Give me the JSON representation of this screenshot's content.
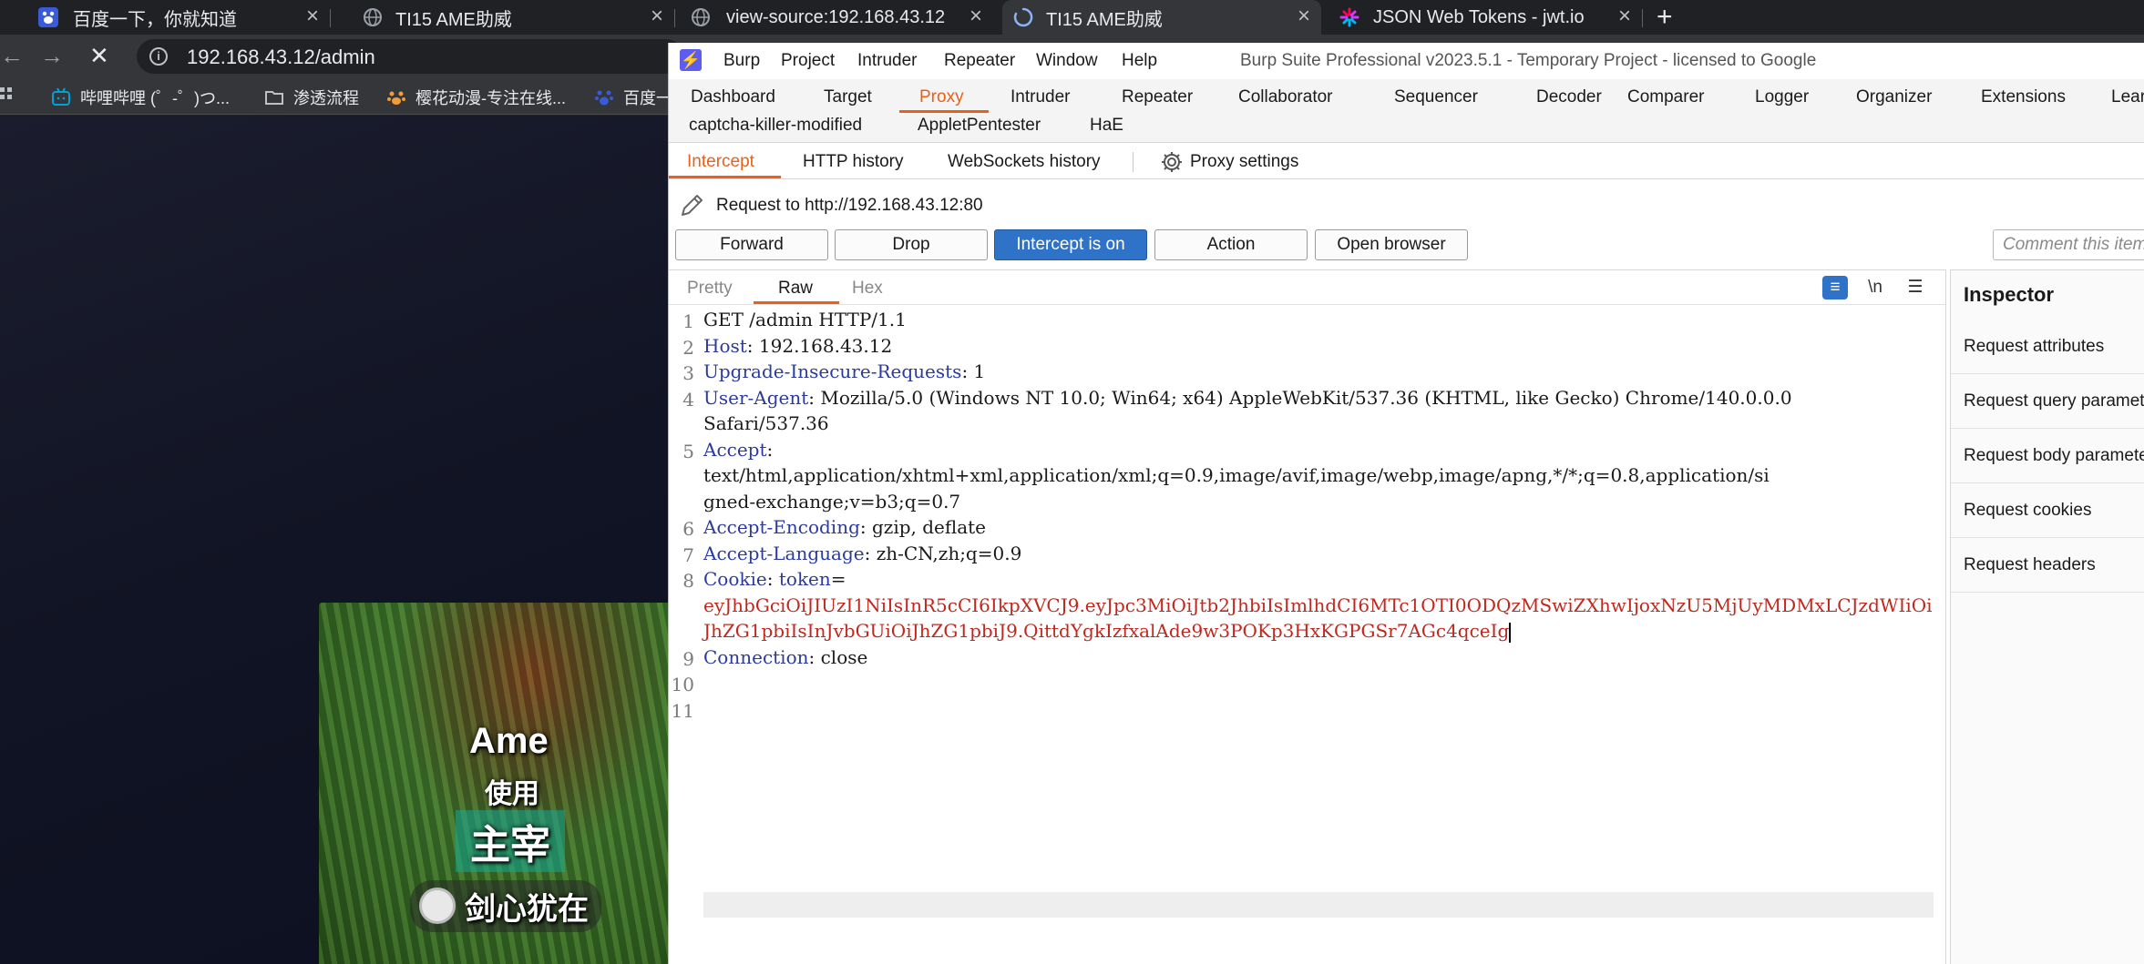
{
  "browser": {
    "tabs": [
      {
        "title": "百度一下，你就知道",
        "icon": "baidu-paw-icon"
      },
      {
        "title": "TI15 AME助威",
        "icon": "globe-icon"
      },
      {
        "title": "view-source:192.168.43.12",
        "icon": "globe-icon"
      },
      {
        "title": "TI15 AME助威",
        "icon": "loading-spinner-icon"
      },
      {
        "title": "JSON Web Tokens - jwt.io",
        "icon": "jwt-icon"
      }
    ],
    "address": "192.168.43.12/admin",
    "bookmarks": [
      {
        "label": "哔哩哔哩 (゜-゜)つ...",
        "icon": "bilibili-icon"
      },
      {
        "label": "渗透流程",
        "icon": "folder-icon"
      },
      {
        "label": "樱花动漫-专注在线...",
        "icon": "paw-icon"
      },
      {
        "label": "百度一",
        "icon": "baidu-paw-icon"
      }
    ],
    "video_overlay": {
      "line1": "Ame",
      "line2": "使用",
      "line3": "主宰",
      "line4": "剑心犹在"
    }
  },
  "burp": {
    "menu": [
      "Burp",
      "Project",
      "Intruder",
      "Repeater",
      "Window",
      "Help"
    ],
    "title": "Burp Suite Professional v2023.5.1 - Temporary Project - licensed to Google",
    "main_tabs_row1": [
      "Dashboard",
      "Target",
      "Proxy",
      "Intruder",
      "Repeater",
      "Collaborator",
      "Sequencer",
      "Decoder",
      "Comparer",
      "Logger",
      "Organizer",
      "Extensions",
      "Lear"
    ],
    "main_tabs_row2": [
      "captcha-killer-modified",
      "AppletPentester",
      "HaE"
    ],
    "active_main_tab": "Proxy",
    "sub_tabs": [
      "Intercept",
      "HTTP history",
      "WebSockets history"
    ],
    "proxy_settings": "Proxy settings",
    "request_to": "Request to http://192.168.43.12:80",
    "buttons": {
      "forward": "Forward",
      "drop": "Drop",
      "intercept": "Intercept is on",
      "action": "Action",
      "open_browser": "Open browser"
    },
    "comment_placeholder": "Comment this item",
    "editor_tabs": [
      "Pretty",
      "Raw",
      "Hex"
    ],
    "editor_icons": {
      "newline": "\\n"
    },
    "request_lines": [
      {
        "n": "1",
        "key": "",
        "val": "GET /admin HTTP/1.1"
      },
      {
        "n": "2",
        "key": "Host",
        "val": ": 192.168.43.12"
      },
      {
        "n": "3",
        "key": "Upgrade-Insecure-Requests",
        "val": ": 1"
      },
      {
        "n": "4",
        "key": "User-Agent",
        "val": ": Mozilla/5.0 (Windows NT 10.0; Win64; x64) AppleWebKit/537.36 (KHTML, like Gecko) Chrome/140.0.0.0"
      },
      {
        "n": "",
        "key": "",
        "val": "Safari/537.36"
      },
      {
        "n": "5",
        "key": "Accept",
        "val": ":"
      },
      {
        "n": "",
        "key": "",
        "val": "text/html,application/xhtml+xml,application/xml;q=0.9,image/avif,image/webp,image/apng,*/*;q=0.8,application/si"
      },
      {
        "n": "",
        "key": "",
        "val": "gned-exchange;v=b3;q=0.7"
      },
      {
        "n": "6",
        "key": "Accept-Encoding",
        "val": ": gzip, deflate"
      },
      {
        "n": "7",
        "key": "Accept-Language",
        "val": ": zh-CN,zh;q=0.9"
      },
      {
        "n": "8",
        "key": "Cookie",
        "val": ": ",
        "cookie_name": "token",
        "cookie_eq": "="
      },
      {
        "n": "",
        "key": "",
        "val": "",
        "red": "eyJhbGciOiJIUzI1NiIsInR5cCI6IkpXVCJ9.eyJpc3MiOiJtb2JhbiIsImlhdCI6MTc1OTI0ODQzMSwiZXhwIjoxNzU5MjUyMDMxLCJzdWIiOi"
      },
      {
        "n": "",
        "key": "",
        "val": "",
        "red": "JhZG1pbiIsInJvbGUiOiJhZG1pbiJ9.QittdYgkIzfxalAde9w3POKp3HxKGPGSr7AGc4qceIg"
      },
      {
        "n": "9",
        "key": "Connection",
        "val": ": close"
      },
      {
        "n": "10",
        "key": "",
        "val": ""
      },
      {
        "n": "11",
        "key": "",
        "val": ""
      }
    ],
    "inspector": {
      "title": "Inspector",
      "items": [
        "Request attributes",
        "Request query parameters",
        "Request body parameters",
        "Request cookies",
        "Request headers"
      ]
    }
  }
}
